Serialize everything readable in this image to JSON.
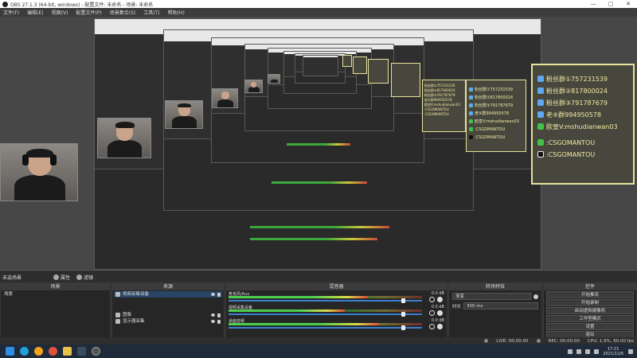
{
  "window": {
    "title": "OBS 27.1.3 (64-bit, windows) - 配置文件: 未命名 - 场景: 未命名",
    "minimize": "—",
    "maximize": "▢",
    "close": "✕"
  },
  "menu": [
    "文件(F)",
    "编辑(E)",
    "视图(V)",
    "配置文件(P)",
    "场景集合(S)",
    "工具(T)",
    "帮助(H)"
  ],
  "overlay": {
    "lines": [
      {
        "icon": "qq-icon",
        "color": "#5fa8ef",
        "text": "粉丝群①757231539"
      },
      {
        "icon": "qq-icon",
        "color": "#5fa8ef",
        "text": "粉丝群②817800024"
      },
      {
        "icon": "qq-icon",
        "color": "#5fa8ef",
        "text": "粉丝群③791787679"
      },
      {
        "icon": "qq-icon",
        "color": "#5fa8ef",
        "text": "老④群994950578"
      },
      {
        "icon": "wechat-icon",
        "color": "#45c04b",
        "text": "欧皇V:mshudianwan03"
      },
      {
        "icon": "wechat-icon",
        "color": "#45c04b",
        "text": ":CSGOMANTOU"
      },
      {
        "icon": "tiktok-icon",
        "color": "#111111",
        "text": ":CSGOMANTOU"
      }
    ]
  },
  "scene_toolbar": {
    "label": "未选场景",
    "props": "属性",
    "filters": "滤镜"
  },
  "panels": {
    "scenes": {
      "title": "场景",
      "items": [
        "场景"
      ]
    },
    "sources": {
      "title": "来源",
      "items": [
        "视频采集设备",
        "图像",
        "显示器采集"
      ]
    },
    "mixer": {
      "title": "混音器",
      "channels": [
        {
          "name": "麦克风/Aux",
          "db": "0.0 dB",
          "level": 0.72,
          "volume": 0.9
        },
        {
          "name": "视频采集设备",
          "db": "0.0 dB",
          "level": 0.6,
          "volume": 0.9
        },
        {
          "name": "桌面音频",
          "db": "0.0 dB",
          "level": 0.78,
          "volume": 0.9
        }
      ]
    },
    "transitions": {
      "title": "转场特效",
      "type": "渐变",
      "duration_label": "时长",
      "duration": "300 ms"
    },
    "controls": {
      "title": "控件",
      "buttons": [
        "开始推流",
        "开始录制",
        "启动虚拟摄像机",
        "工作室模式",
        "设置",
        "退出"
      ]
    }
  },
  "status": {
    "live": "LIVE: 00:00:00",
    "rec": "REC: 00:00:00",
    "cpu": "CPU: 1.9%, 60.00 fps"
  },
  "taskbar": {
    "time": "17:21",
    "date": "2021/12/6"
  }
}
